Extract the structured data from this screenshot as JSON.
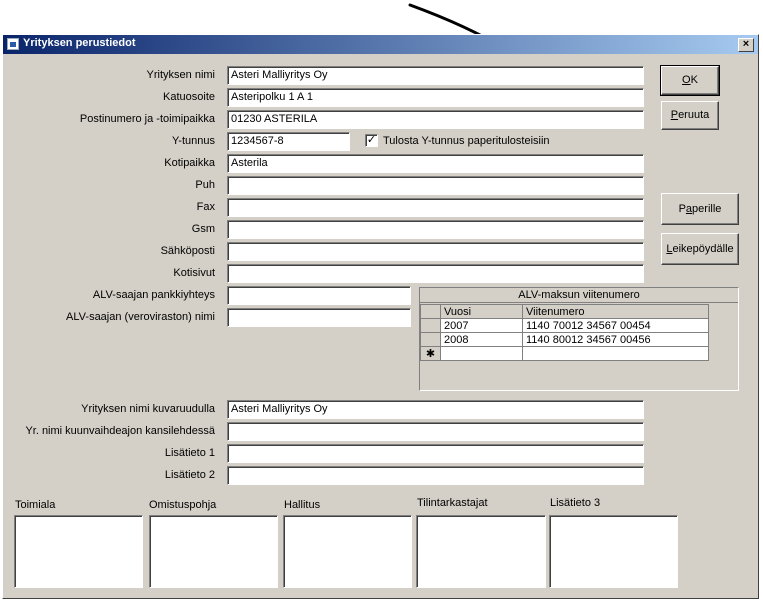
{
  "window": {
    "title": "Yrityksen perustiedot",
    "close_label": "×"
  },
  "labels": {
    "name": "Yrityksen nimi",
    "street": "Katuosoite",
    "postal": "Postinumero ja -toimipaikka",
    "ytunnus": "Y-tunnus",
    "kotipaikka": "Kotipaikka",
    "puh": "Puh",
    "fax": "Fax",
    "gsm": "Gsm",
    "email": "Sähköposti",
    "website": "Kotisivut",
    "alv_bank": "ALV-saajan pankkiyhteys",
    "alv_name": "ALV-saajan (veroviraston) nimi",
    "name_image": "Yrityksen nimi kuvaruudulla",
    "name_cover": "Yr. nimi kuunvaihdeajon kansilehdessä",
    "extra1": "Lisätieto 1",
    "extra2": "Lisätieto 2"
  },
  "values": {
    "name": "Asteri Malliyritys Oy",
    "street": "Asteripolku 1 A 1",
    "postal": "01230 ASTERILA",
    "ytunnus": "1234567-8",
    "kotipaikka": "Asterila",
    "puh": "",
    "fax": "",
    "gsm": "",
    "email": "",
    "website": "",
    "alv_bank": "",
    "alv_name": "",
    "name_image": "Asteri Malliyritys Oy",
    "name_cover": "",
    "extra1": "",
    "extra2": ""
  },
  "checkbox": {
    "label": "Tulosta Y-tunnus paperitulosteisiin",
    "mark": "✓",
    "checked": true
  },
  "buttons": {
    "ok": "OK",
    "cancel": "Peruuta",
    "paper": "Paperille",
    "clipboard": "Leikepöydälle"
  },
  "grid": {
    "title": "ALV-maksun viitenumero",
    "columns": [
      "Vuosi",
      "Viitenumero"
    ],
    "rows": [
      {
        "year": "2007",
        "ref": "1140 70012 34567 00454"
      },
      {
        "year": "2008",
        "ref": "1140 80012 34567 00456"
      }
    ],
    "new_row_marker": "✱"
  },
  "memos": {
    "industry": "Toimiala",
    "ownership": "Omistuspohja",
    "board": "Hallitus",
    "auditors": "Tilintarkastajat",
    "extra3": "Lisätieto 3"
  }
}
